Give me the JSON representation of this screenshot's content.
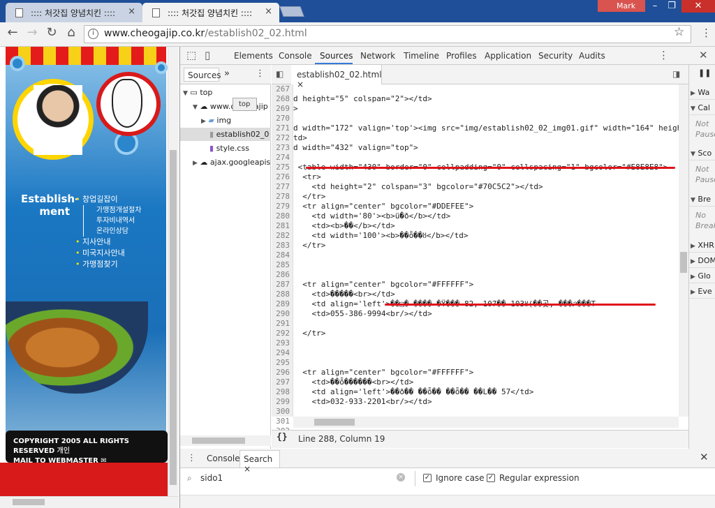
{
  "browser": {
    "tabs": [
      {
        "title": ":::: 처갓집 양념치킨 ::::",
        "active": false
      },
      {
        "title": ":::: 처갓집 양념치킨 ::::",
        "active": true
      }
    ],
    "profile_name": "Mark",
    "url_domain": "www.cheogajip.co.kr",
    "url_path": "/establish02_02.html"
  },
  "website": {
    "section_title": "Establish-\nment",
    "menu": [
      {
        "label": "창업길잡이",
        "sub": [
          "가맹점개설절차",
          "투자비내역서",
          "온라인상담"
        ]
      },
      {
        "label": "지사안내",
        "sub": []
      },
      {
        "label": "미국지사안내",
        "sub": []
      },
      {
        "label": "가맹점찾기",
        "sub": []
      }
    ],
    "copyright": "COPYRIGHT 2005 ALL RIGHTS RESERVED",
    "copyright_clip": "개인",
    "webmaster": "MAIL TO WEBMASTER"
  },
  "devtools": {
    "panels": [
      "Elements",
      "Console",
      "Sources",
      "Network",
      "Timeline",
      "Profiles",
      "Application",
      "Security",
      "Audits"
    ],
    "active_panel": "Sources",
    "navigator": {
      "tab": "Sources",
      "tree": [
        {
          "label": "top",
          "depth": 0
        },
        {
          "label": "www.cheogajip",
          "depth": 1
        },
        {
          "label": "img",
          "depth": 2
        },
        {
          "label": "establish02_0",
          "depth": 2
        },
        {
          "label": "style.css",
          "depth": 2
        },
        {
          "label": "ajax.googleapis",
          "depth": 1
        }
      ],
      "tooltip": "top"
    },
    "editor_tab": "establish02_02.html",
    "code_lines": [
      {
        "n": "267",
        "t": ""
      },
      {
        "n": "268",
        "t": "d height=\"5\" colspan=\"2\"></td>"
      },
      {
        "n": "269",
        "t": ">"
      },
      {
        "n": "270",
        "t": ""
      },
      {
        "n": "271",
        "t": "d width=\"172\" valign='top'><img src=\"img/establish02_02_img01.gif\" width=\"164\" heigh"
      },
      {
        "n": "272",
        "t": "td>"
      },
      {
        "n": "273",
        "t": "d width=\"432\" valign=\"top\">"
      },
      {
        "n": "274",
        "t": ""
      },
      {
        "n": "275",
        "t": " <table width=\"430\" border=\"0\" cellpadding=\"0\" cellspacing=\"1\" bgcolor=\"#E8E8E8\">"
      },
      {
        "n": "276",
        "t": "  <tr>"
      },
      {
        "n": "277",
        "t": "    <td height=\"2\" colspan=\"3\" bgcolor=\"#70C5C2\"></td>"
      },
      {
        "n": "278",
        "t": "  </tr>"
      },
      {
        "n": "279",
        "t": "  <tr align=\"center\" bgcolor=\"#DDEFEE\">"
      },
      {
        "n": "280",
        "t": "    <td width='80'><b>ü�ð</b></td>"
      },
      {
        "n": "281",
        "t": "    <td><b>��</b></td>"
      },
      {
        "n": "282",
        "t": "    <td width='100'><b>��ȭ��ȣ</b></td>"
      },
      {
        "n": "283",
        "t": "  </tr>"
      },
      {
        "n": "284",
        "t": ""
      },
      {
        "n": "285",
        "t": ""
      },
      {
        "n": "286",
        "t": ""
      },
      {
        "n": "287",
        "t": "  <tr align=\"center\" bgcolor=\"#FFFFFF\">"
      },
      {
        "n": "288",
        "t": "    <td>�����<br></td>"
      },
      {
        "n": "289",
        "t": "    <td align='left'>��□� ���� �Ÿ��� 82, 107�� 103ȣ(��곳, ���ጋ���T"
      },
      {
        "n": "290",
        "t": "    <td>055-386-9994<br/></td>"
      },
      {
        "n": "291",
        "t": ""
      },
      {
        "n": "292",
        "t": "  </tr>"
      },
      {
        "n": "293",
        "t": ""
      },
      {
        "n": "294",
        "t": ""
      },
      {
        "n": "295",
        "t": ""
      },
      {
        "n": "296",
        "t": "  <tr align=\"center\" bgcolor=\"#FFFFFF\">"
      },
      {
        "n": "297",
        "t": "    <td>��ȭ������<br></td>"
      },
      {
        "n": "298",
        "t": "    <td align='left'>��ð�� ��ȭ�� ��ȭ�� ��L�� 57</td>"
      },
      {
        "n": "299",
        "t": "    <td>032-933-2201<br/></td>"
      },
      {
        "n": "300",
        "t": ""
      },
      {
        "n": "301",
        "t": "  </tr>"
      },
      {
        "n": "302",
        "t": ""
      }
    ],
    "status": "Line 288, Column 19",
    "debugger_sections": [
      {
        "label": "Wa",
        "note": ""
      },
      {
        "label": "Cal",
        "note": "Not Pause"
      },
      {
        "label": "Sco",
        "note": "Not Pause"
      },
      {
        "label": "Bre",
        "note": "No Break"
      },
      {
        "label": "XHR",
        "note": ""
      },
      {
        "label": "DOM",
        "note": ""
      },
      {
        "label": "Glo",
        "note": ""
      },
      {
        "label": "Eve",
        "note": ""
      }
    ],
    "drawer_tabs": [
      "Console",
      "Search"
    ],
    "active_drawer_tab": "Search",
    "search_value": "sido1",
    "ignore_case_label": "Ignore case",
    "regex_label": "Regular expression",
    "ignore_case_checked": true,
    "regex_checked": true
  },
  "colors": {
    "chrome_blue": "#1f4f98",
    "accent_red": "#e0131a",
    "devtools_blue": "#3879d9"
  }
}
